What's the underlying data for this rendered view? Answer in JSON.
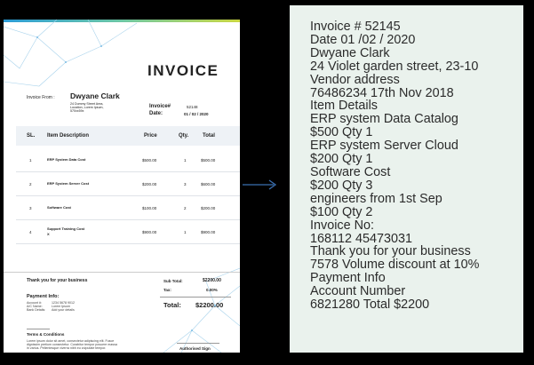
{
  "invoice": {
    "title": "INVOICE",
    "from_label": "Invoice From  :",
    "from_name": "Dwyane Clark",
    "from_address": [
      "24 Dummy Street Area,",
      "Location, Lorem Ipsum,",
      "570xx59x"
    ],
    "invoice_no_label": "Invoice#",
    "invoice_no": "52148",
    "date_label": "Date:",
    "date": "01 / 02 / 2020",
    "headers": {
      "sl": "SL.",
      "item": "Item Description",
      "price": "Price",
      "qty": "Qty.",
      "total": "Total"
    },
    "rows": [
      {
        "sl": "1",
        "item": "ERP System Data Cost",
        "price": "$500.00",
        "qty": "1",
        "total": "$500.00"
      },
      {
        "sl": "2",
        "item": "ERP System Server Cost",
        "price": "$200.00",
        "qty": "3",
        "total": "$600.00"
      },
      {
        "sl": "3",
        "item": "Software Cost",
        "price": "$100.00",
        "qty": "2",
        "total": "$200.00"
      },
      {
        "sl": "4",
        "item": "Support Training Cost",
        "item_line2": "X",
        "price": "$900.00",
        "qty": "1",
        "total": "$900.00"
      }
    ],
    "thanks": "Thank you for your business",
    "payment_title": "Payment Info:",
    "payment_labels": [
      "Account #:",
      "A/C Name:",
      "Bank Details:"
    ],
    "payment_values": [
      "1234 5678 9012",
      "Lorem Ipsum",
      "Add your details"
    ],
    "subtotal_label": "Sub Total:",
    "subtotal": "$2200.00",
    "tax_label": "Tax:",
    "tax": "0.00%",
    "total_label": "Total:",
    "total": "$2200.00",
    "terms_title": "Terms & Conditions",
    "terms_text": [
      "Lorem ipsum dolor sit amet, consectetur adipiscing elit. Fusce",
      "dignissim pretium consectetur. Curabitur tempor posuere massa",
      "in varius. Pellentesque viverra nibh eu vulputate tempor."
    ],
    "signature": "Authorised Sign"
  },
  "extracted_lines": [
    "Invoice # 52145",
    "Date 01 /02 / 2020",
    "Dwyane Clark",
    "24 Violet garden street, 23-10",
    "Vendor address",
    "76486234 17th Nov 2018",
    "Item Details",
    "ERP system Data Catalog",
    "$500 Qty 1",
    "ERP system Server Cloud",
    "$200 Qty 1",
    "Software Cost",
    "$200 Qty 3",
    "engineers from 1st Sep",
    "$100 Qty 2",
    "Invoice No:",
    "168112 45473031",
    "Thank you for your business",
    "7578 Volume discount at 10%",
    "Payment Info",
    "Account Number",
    "6821280 Total $2200"
  ],
  "colors": {
    "background": "#000000",
    "panel": "#eaf2ed",
    "accent_blue": "#1f7fc3",
    "arrow": "#3a6fb0"
  }
}
